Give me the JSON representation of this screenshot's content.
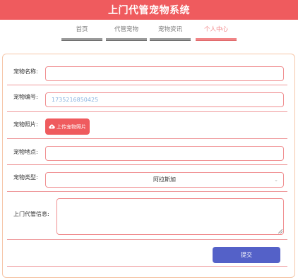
{
  "header": {
    "title": "上门代管宠物系统"
  },
  "nav": {
    "items": [
      {
        "label": "首页"
      },
      {
        "label": "代管宠物"
      },
      {
        "label": "宠物资讯"
      },
      {
        "label": "个人中心"
      }
    ],
    "active_index": 3
  },
  "form": {
    "pet_name": {
      "label": "宠物名称:",
      "value": ""
    },
    "pet_number": {
      "label": "宠物编号:",
      "value": "1735216850425"
    },
    "pet_photo": {
      "label": "宠物照片:",
      "button_label": "上传宠物照片",
      "icon": "cloud-upload-icon"
    },
    "pet_location": {
      "label": "宠物地点:",
      "value": ""
    },
    "pet_type": {
      "label": "宠物类型:",
      "selected": "阿拉斯加",
      "icon": "chevron-down-icon"
    },
    "care_info": {
      "label": "上门代管信息:",
      "value": ""
    },
    "submit_label": "提交"
  },
  "colors": {
    "brand": "#ef5b5e",
    "submit": "#5461c8",
    "field_border": "#f08e90",
    "nav_active": "#f28a8c"
  }
}
